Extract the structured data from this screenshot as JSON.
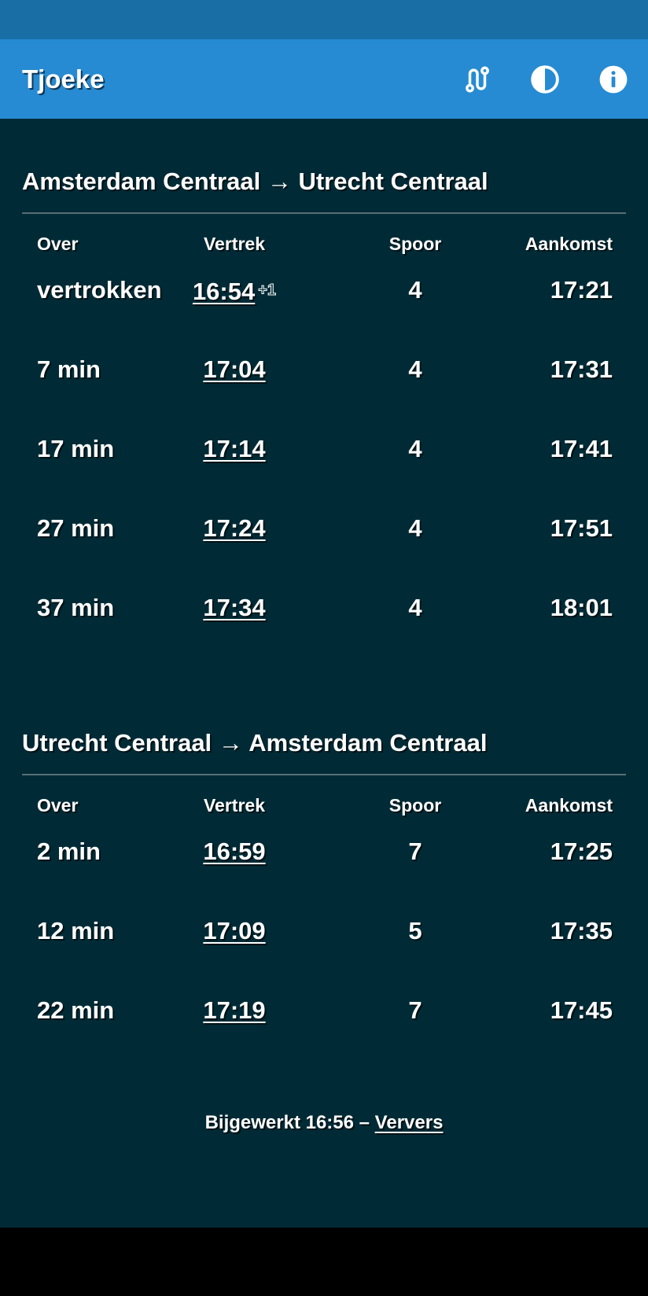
{
  "app": {
    "title": "Tjoeke",
    "icons": [
      "route-icon",
      "contrast-icon",
      "info-icon"
    ]
  },
  "sections": [
    {
      "title": "Amsterdam Centraal → Utrecht Centraal",
      "headers": {
        "over": "Over",
        "vertrek": "Vertrek",
        "spoor": "Spoor",
        "aankomst": "Aankomst"
      },
      "rows": [
        {
          "over": "vertrokken",
          "vertrek": "16:54",
          "delay": "+1",
          "spoor": "4",
          "aankomst": "17:21"
        },
        {
          "over": "7 min",
          "vertrek": "17:04",
          "spoor": "4",
          "aankomst": "17:31"
        },
        {
          "over": "17 min",
          "vertrek": "17:14",
          "spoor": "4",
          "aankomst": "17:41"
        },
        {
          "over": "27 min",
          "vertrek": "17:24",
          "spoor": "4",
          "aankomst": "17:51"
        },
        {
          "over": "37 min",
          "vertrek": "17:34",
          "spoor": "4",
          "aankomst": "18:01"
        }
      ]
    },
    {
      "title": "Utrecht Centraal → Amsterdam Centraal",
      "headers": {
        "over": "Over",
        "vertrek": "Vertrek",
        "spoor": "Spoor",
        "aankomst": "Aankomst"
      },
      "rows": [
        {
          "over": "2 min",
          "vertrek": "16:59",
          "spoor": "7",
          "aankomst": "17:25"
        },
        {
          "over": "12 min",
          "vertrek": "17:09",
          "spoor": "5",
          "aankomst": "17:35"
        },
        {
          "over": "22 min",
          "vertrek": "17:19",
          "spoor": "7",
          "aankomst": "17:45"
        }
      ]
    }
  ],
  "footer": {
    "updated": "Bijgewerkt 16:56 – ",
    "refresh": "Ververs"
  },
  "colors": {
    "status_bar": "#1a6ea6",
    "app_bar": "#268bd2",
    "background": "#002b36",
    "divider": "#586e75",
    "text": "#ffffff"
  }
}
